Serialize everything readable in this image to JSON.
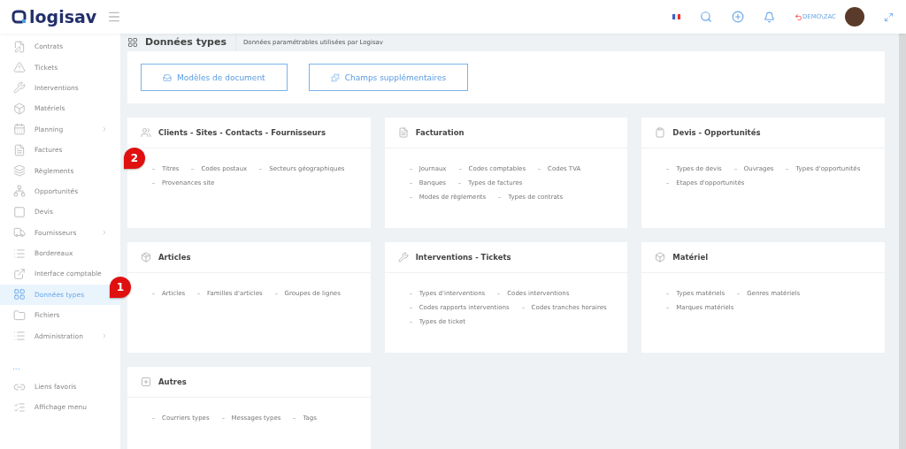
{
  "header": {
    "brand": "logisav",
    "user": "DEMO\\ZAC"
  },
  "sidebar": {
    "items": [
      {
        "label": "Contrats",
        "selected": false,
        "submenu": false
      },
      {
        "label": "Tickets",
        "selected": false,
        "submenu": false
      },
      {
        "label": "Interventions",
        "selected": false,
        "submenu": false
      },
      {
        "label": "Matériels",
        "selected": false,
        "submenu": false
      },
      {
        "label": "Planning",
        "selected": false,
        "submenu": true
      },
      {
        "label": "Factures",
        "selected": false,
        "submenu": false
      },
      {
        "label": "Règlements",
        "selected": false,
        "submenu": false
      },
      {
        "label": "Opportunités",
        "selected": false,
        "submenu": false
      },
      {
        "label": "Devis",
        "selected": false,
        "submenu": false
      },
      {
        "label": "Fournisseurs",
        "selected": false,
        "submenu": true
      },
      {
        "label": "Bordereaux",
        "selected": false,
        "submenu": false
      },
      {
        "label": "Interface comptable",
        "selected": false,
        "submenu": false
      },
      {
        "label": "Données types",
        "selected": true,
        "submenu": false,
        "callout": "1"
      },
      {
        "label": "Fichiers",
        "selected": false,
        "submenu": false
      },
      {
        "label": "Administration",
        "selected": false,
        "submenu": true
      }
    ],
    "more": "...",
    "extras": [
      {
        "label": "Liens favoris"
      },
      {
        "label": "Affichage menu"
      }
    ]
  },
  "page": {
    "title": "Données types",
    "subtitle": "Données paramétrables utilisées par Logisav"
  },
  "buttons": [
    {
      "label": "Modèles de document"
    },
    {
      "label": "Champs supplémentaires"
    }
  ],
  "cards": [
    {
      "title": "Clients - Sites - Contacts - Fournisseurs",
      "links": [
        {
          "label": "Titres",
          "callout": "2"
        },
        {
          "label": "Codes postaux"
        },
        {
          "label": "Secteurs géographiques"
        },
        {
          "label": "Provenances site"
        }
      ]
    },
    {
      "title": "Facturation",
      "links": [
        {
          "label": "Journaux"
        },
        {
          "label": "Codes comptables"
        },
        {
          "label": "Codes TVA"
        },
        {
          "label": "Banques"
        },
        {
          "label": "Types de factures"
        },
        {
          "label": "Modes de règlements"
        },
        {
          "label": "Types de contrats"
        }
      ]
    },
    {
      "title": "Devis - Opportunités",
      "links": [
        {
          "label": "Types de devis"
        },
        {
          "label": "Ouvrages"
        },
        {
          "label": "Types d'opportunités"
        },
        {
          "label": "Etapes d'opportunités"
        }
      ]
    },
    {
      "title": "Articles",
      "links": [
        {
          "label": "Articles"
        },
        {
          "label": "Familles d'articles"
        },
        {
          "label": "Groupes de lignes"
        }
      ]
    },
    {
      "title": "Interventions - Tickets",
      "links": [
        {
          "label": "Types d'interventions"
        },
        {
          "label": "Codes interventions"
        },
        {
          "label": "Codes rapports interventions"
        },
        {
          "label": "Codes tranches horaires"
        },
        {
          "label": "Types de ticket"
        }
      ]
    },
    {
      "title": "Matériel",
      "links": [
        {
          "label": "Types matériels"
        },
        {
          "label": "Genres matériels"
        },
        {
          "label": "Marques matériels"
        }
      ]
    },
    {
      "title": "Autres",
      "links": [
        {
          "label": "Courriers types"
        },
        {
          "label": "Messages types"
        },
        {
          "label": "Tags"
        }
      ]
    }
  ]
}
